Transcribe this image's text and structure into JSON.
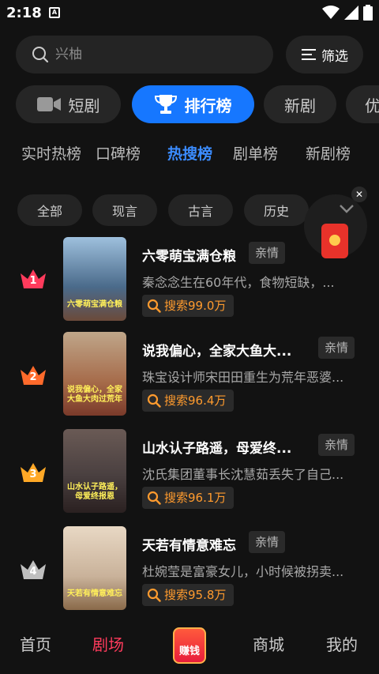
{
  "status_bar": {
    "time": "2:18",
    "app_icon_letter": "A"
  },
  "search": {
    "placeholder": "兴柚",
    "filter_label": "筛选"
  },
  "categories": [
    {
      "label": "短剧",
      "icon": "video-camera-icon",
      "active": false
    },
    {
      "label": "排行榜",
      "icon": "trophy-icon",
      "active": true
    },
    {
      "label": "新剧",
      "active": false
    },
    {
      "label": "优",
      "active": false
    }
  ],
  "rank_tabs": [
    "实时热榜",
    "口碑榜",
    "热搜榜",
    "剧单榜",
    "新剧榜"
  ],
  "active_rank_tab": "热搜榜",
  "chips": [
    "全部",
    "现言",
    "古言",
    "历史"
  ],
  "items": [
    {
      "rank": "1",
      "title": "六零萌宝满仓粮",
      "genre": "亲情",
      "desc": "秦念念生在60年代，食物短缺，...",
      "count": "搜索99.0万",
      "crown_color": "#ff3b5c",
      "poster_text": "六零萌宝满仓粮",
      "poster_bg": "#6b8fb3"
    },
    {
      "rank": "2",
      "title": "说我偏心，全家大鱼大...",
      "genre": "亲情",
      "desc": "珠宝设计师宋田田重生为荒年恶婆...",
      "count": "搜索96.4万",
      "crown_color": "#ff6a2b",
      "poster_text": "说我偏心，全家大鱼大肉过荒年",
      "poster_bg": "#a66b4a"
    },
    {
      "rank": "3",
      "title": "山水认子路遥，母爱终...",
      "genre": "亲情",
      "desc": "沈氏集团董事长沈慧茹丢失了自己...",
      "count": "搜索96.1万",
      "crown_color": "#ffa826",
      "poster_text": "山水认子路遥，母爱终报恩",
      "poster_bg": "#4a4040"
    },
    {
      "rank": "4",
      "title": "天若有情意难忘",
      "genre": "亲情",
      "desc": "杜婉莹是富豪女儿，小时候被拐卖...",
      "count": "搜索95.8万",
      "crown_color": "#bfbfbf",
      "poster_text": "天若有情意难忘",
      "poster_bg": "#c9b29a"
    }
  ],
  "bottom_nav": [
    {
      "label": "首页",
      "active": false
    },
    {
      "label": "剧场",
      "active": true
    },
    {
      "label": "赚钱",
      "active": false
    },
    {
      "label": "商城",
      "active": false
    },
    {
      "label": "我的",
      "active": false
    }
  ],
  "colors": {
    "accent_blue": "#1677ff",
    "active_red": "#ff3b5c",
    "search_orange": "#ff9b2e"
  }
}
